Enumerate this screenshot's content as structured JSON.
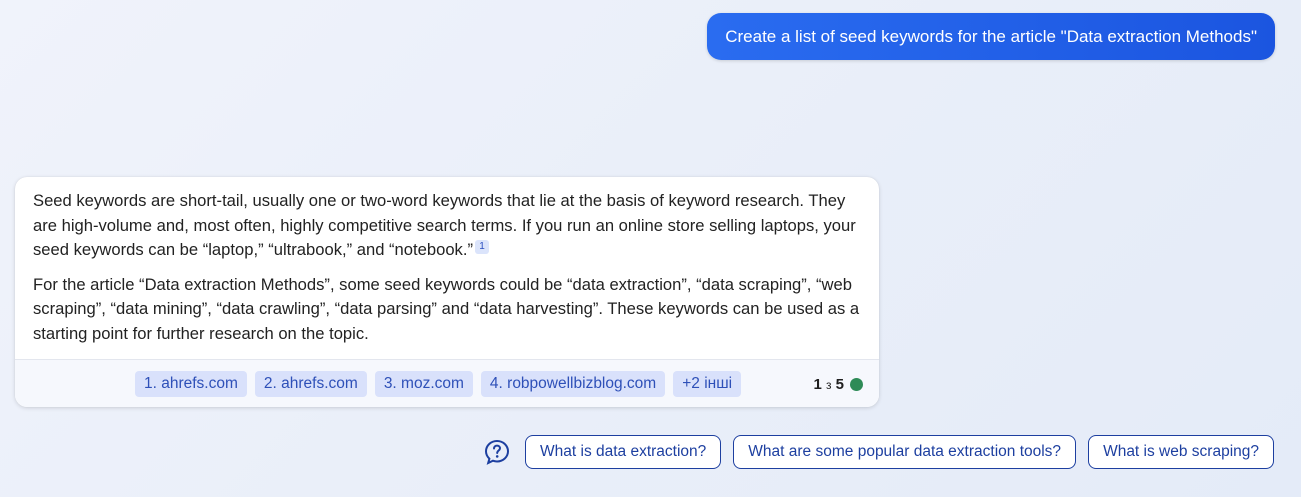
{
  "user_message": "Create a list of seed keywords for the article \"Data extraction Methods\"",
  "bot": {
    "paragraph1": "Seed keywords are short-tail, usually one or two-word keywords that lie at the basis of keyword research. They are high-volume and, most often, highly competitive search terms. If you run an online store selling laptops, your seed keywords can be “laptop,” “ultrabook,” and “notebook.”",
    "citation": "1",
    "paragraph2": "For the article “Data extraction Methods”, some seed keywords could be “data extraction”, “data scraping”, “web scraping”, “data mining”, “data crawling”, “data parsing” and “data harvesting”. These keywords can be used as a starting point for further research on the topic."
  },
  "sources": [
    "1. ahrefs.com",
    "2. ahrefs.com",
    "3. moz.com",
    "4. robpowellbizblog.com",
    "+2 інші"
  ],
  "page_count": {
    "current": "1",
    "separator": "з",
    "total": "5"
  },
  "status_color": "#2e8b57",
  "help_icon": "question-bubble-icon",
  "suggestions": [
    "What is data extraction?",
    "What are some popular data extraction tools?",
    "What is web scraping?"
  ]
}
